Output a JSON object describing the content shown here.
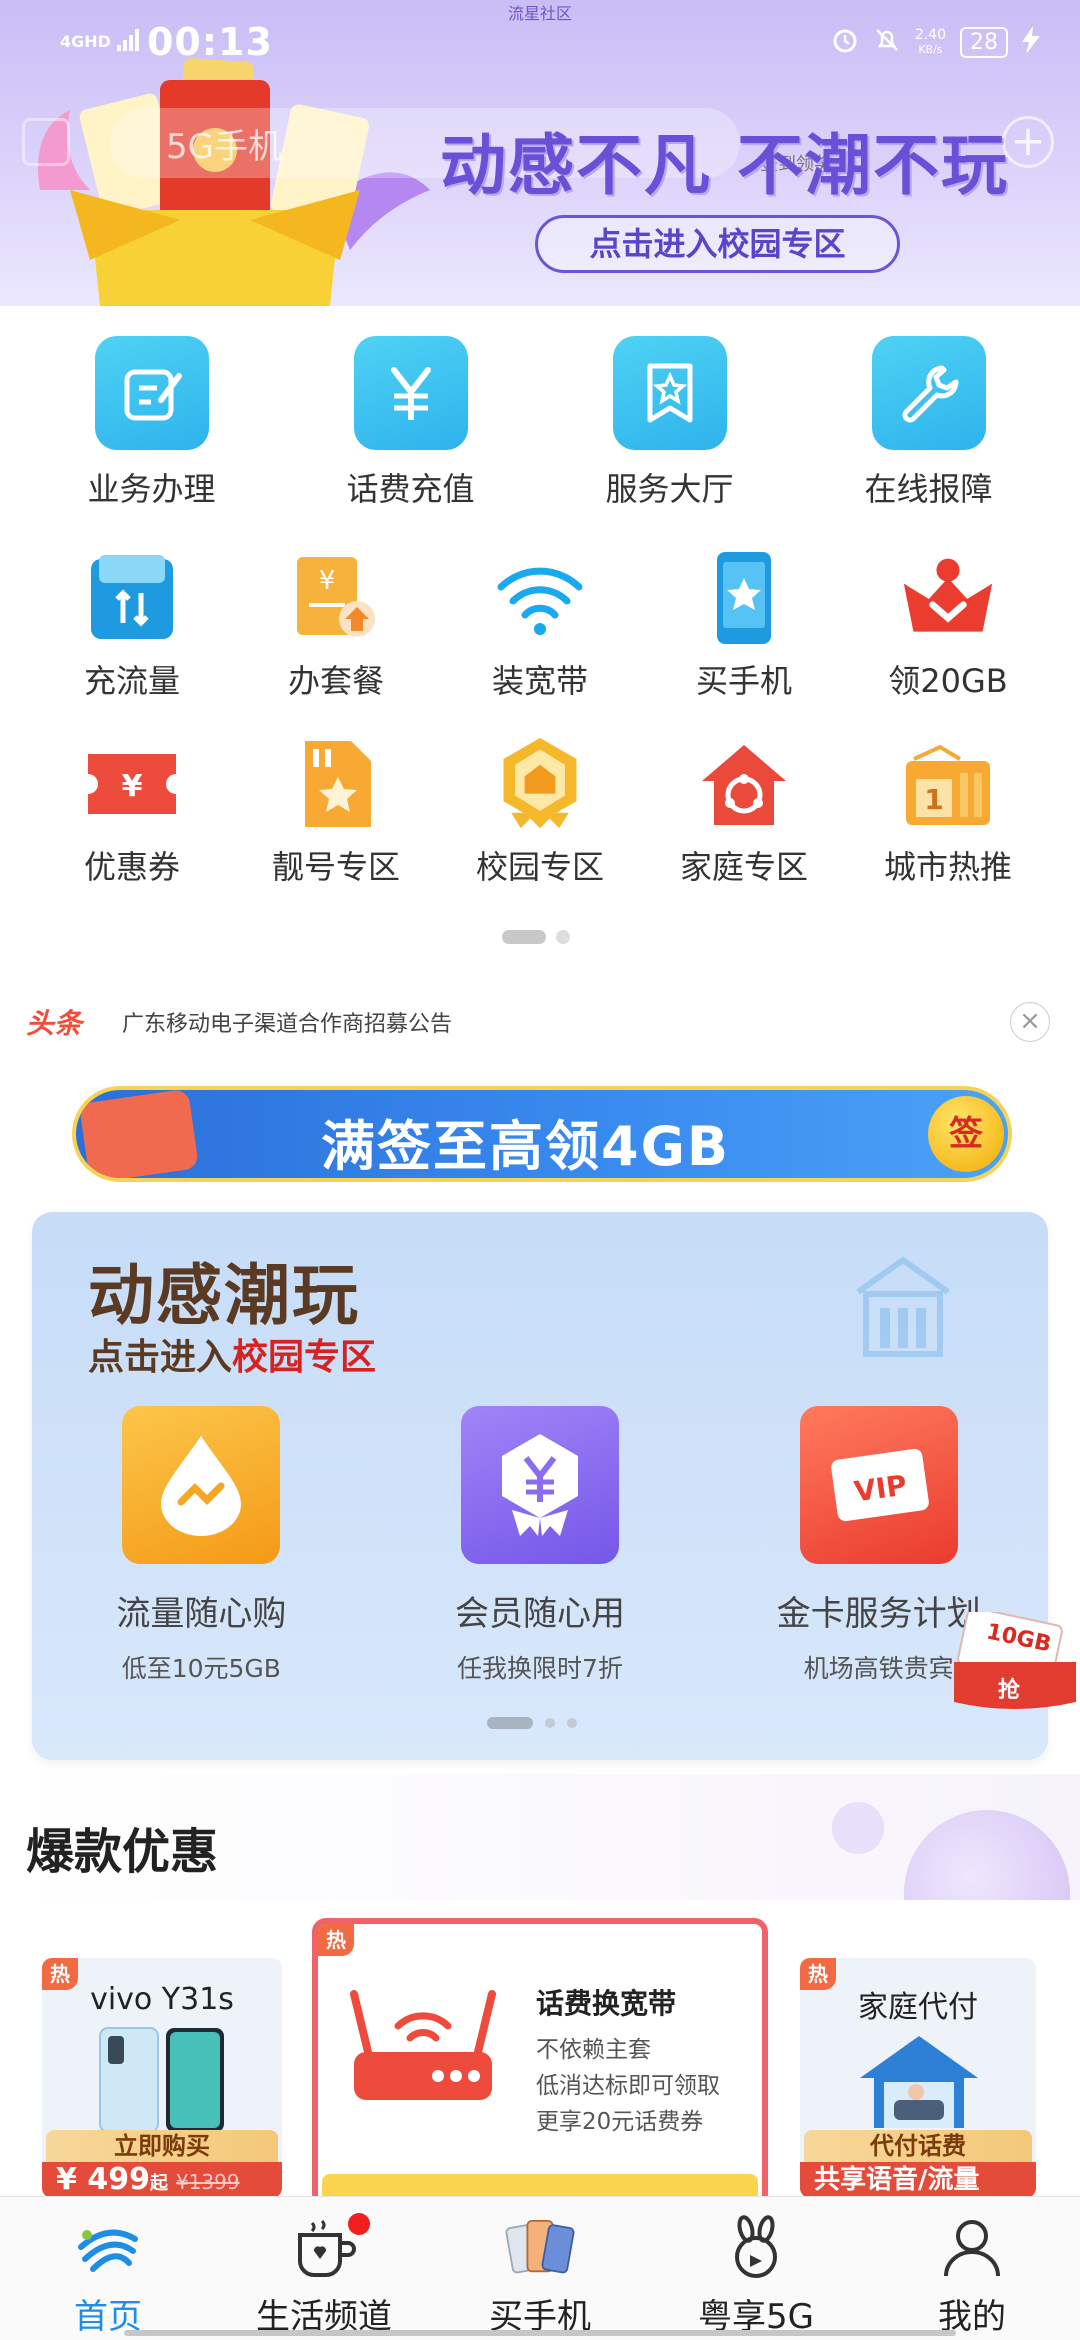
{
  "status_bar": {
    "network": "4GHD",
    "time": "00:13",
    "speed_value": "2.40",
    "speed_unit": "KB/s",
    "battery": "28",
    "notch_text": "流星社区"
  },
  "top_banner": {
    "search_placeholder": "5G手机",
    "signin_label": "签到领奖",
    "headline": "动感不凡 不潮不玩",
    "cta": "点击进入校园专区"
  },
  "main_services": [
    {
      "label": "业务办理",
      "icon": "edit-icon"
    },
    {
      "label": "话费充值",
      "icon": "yuan-icon"
    },
    {
      "label": "服务大厅",
      "icon": "bookmark-star-icon"
    },
    {
      "label": "在线报障",
      "icon": "wrench-icon"
    }
  ],
  "sub_services_row1": [
    {
      "label": "充流量",
      "icon": "data-card-icon"
    },
    {
      "label": "办套餐",
      "icon": "package-icon"
    },
    {
      "label": "装宽带",
      "icon": "wifi-icon"
    },
    {
      "label": "买手机",
      "icon": "phone-star-icon"
    },
    {
      "label": "领20GB",
      "icon": "crown-icon"
    }
  ],
  "sub_services_row2": [
    {
      "label": "优惠券",
      "icon": "coupon-icon"
    },
    {
      "label": "靓号专区",
      "icon": "sim-star-icon"
    },
    {
      "label": "校园专区",
      "icon": "campus-badge-icon"
    },
    {
      "label": "家庭专区",
      "icon": "home-icon"
    },
    {
      "label": "城市热推",
      "icon": "calendar-box-icon"
    }
  ],
  "headline_news": {
    "tag": "头条",
    "text": "广东移动电子渠道合作商招募公告"
  },
  "sign_banner": {
    "text": "满签至高领4GB",
    "badge": "签"
  },
  "campus_card": {
    "title": "动感潮玩",
    "subtitle_prefix": "点击进入",
    "subtitle_highlight": "校园专区",
    "items": [
      {
        "name": "流量随心购",
        "desc": "低至10元5GB",
        "icon": "drop-icon",
        "color": "#f7a623"
      },
      {
        "name": "会员随心用",
        "desc": "任我换限时7折",
        "icon": "member-yuan-icon",
        "color": "#8a6cf0"
      },
      {
        "name": "金卡服务计划",
        "desc": "机场高铁贵宾",
        "icon": "vip-icon",
        "color": "#f05a46"
      }
    ],
    "float_badge_line1": "10GB",
    "float_badge_line2": "抢"
  },
  "hot_deals": {
    "title": "爆款优惠",
    "left": {
      "tag": "热",
      "name": "vivo Y31s",
      "button": "立即购买",
      "price": "¥ 499",
      "price_suffix": "起",
      "old_price": "¥1399"
    },
    "center": {
      "tag": "热",
      "title": "话费换宽带",
      "line1": "不依赖主套",
      "line2": "低消达标即可领取",
      "line3": "更享20元话费券"
    },
    "right": {
      "tag": "热",
      "name": "家庭代付",
      "button": "代付话费",
      "price": "共享语音/流量"
    }
  },
  "bottom_nav": [
    {
      "label": "首页",
      "icon": "china-mobile-logo-icon",
      "active": true
    },
    {
      "label": "生活频道",
      "icon": "coffee-cup-icon",
      "active": false
    },
    {
      "label": "买手机",
      "icon": "phones-icon",
      "active": false
    },
    {
      "label": "粤享5G",
      "icon": "rabbit-icon",
      "active": false
    },
    {
      "label": "我的",
      "icon": "user-icon",
      "active": false
    }
  ]
}
